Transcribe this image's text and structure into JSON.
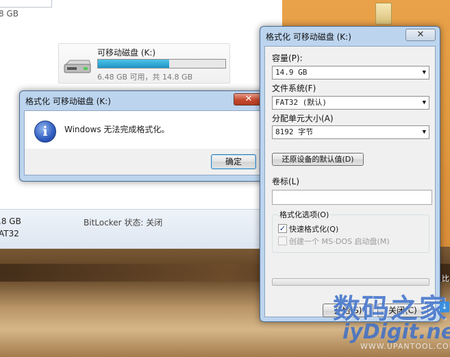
{
  "explorer": {
    "top_size_text": "8 GB",
    "drive": {
      "name": "可移动磁盘 (K:)",
      "usage": "6.48 GB 可用，共 14.8 GB",
      "used_fraction": 0.56
    },
    "details": {
      "size": ".8 GB",
      "fs": "AT32",
      "bitlocker": "BitLocker 状态: 关闭"
    }
  },
  "message_box": {
    "title": "格式化 可移动磁盘 (K:)",
    "close_label": "✕",
    "text": "Windows 无法完成格式化。",
    "ok_label": "确定"
  },
  "format_dialog": {
    "title": "格式化 可移动磁盘 (K:)",
    "close_label": "✕",
    "capacity_label": "容量(P):",
    "capacity_value": "14.9 GB",
    "filesystem_label": "文件系统(F)",
    "filesystem_value": "FAT32 (默认)",
    "allocation_label": "分配单元大小(A)",
    "allocation_value": "8192 字节",
    "restore_defaults_label": "还原设备的默认值(D)",
    "volume_label_label": "卷标(L)",
    "volume_label_value": "",
    "options_label": "格式化选项(O)",
    "quick_format_label": "快速格式化(Q)",
    "quick_format_checked": true,
    "msdos_label": "创建一个 MS-DOS 启动盘(M)",
    "msdos_checked": false,
    "progress": 0,
    "start_label": "开始(S)",
    "close_button_label": "关闭(C)"
  },
  "watermark": {
    "main": "数码之家",
    "site": "iyDigit.net",
    "sub": "WWW.UPANTOOL.COM"
  },
  "desktop": {
    "side_text": "比"
  }
}
